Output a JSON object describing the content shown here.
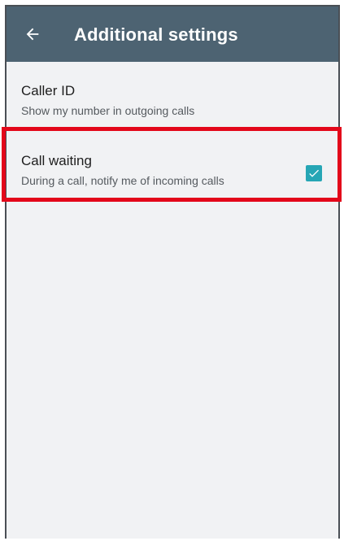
{
  "header": {
    "title": "Additional settings",
    "back_icon": "arrow-left-icon"
  },
  "settings": [
    {
      "title": "Caller ID",
      "subtitle": "Show my number in outgoing calls"
    },
    {
      "title": "Call waiting",
      "subtitle": "During a call, notify me of incoming calls",
      "checked": true
    }
  ],
  "colors": {
    "app_bar": "#4d6372",
    "background": "#f1f2f4",
    "checkbox": "#26a6b5",
    "highlight": "#e3071a"
  }
}
